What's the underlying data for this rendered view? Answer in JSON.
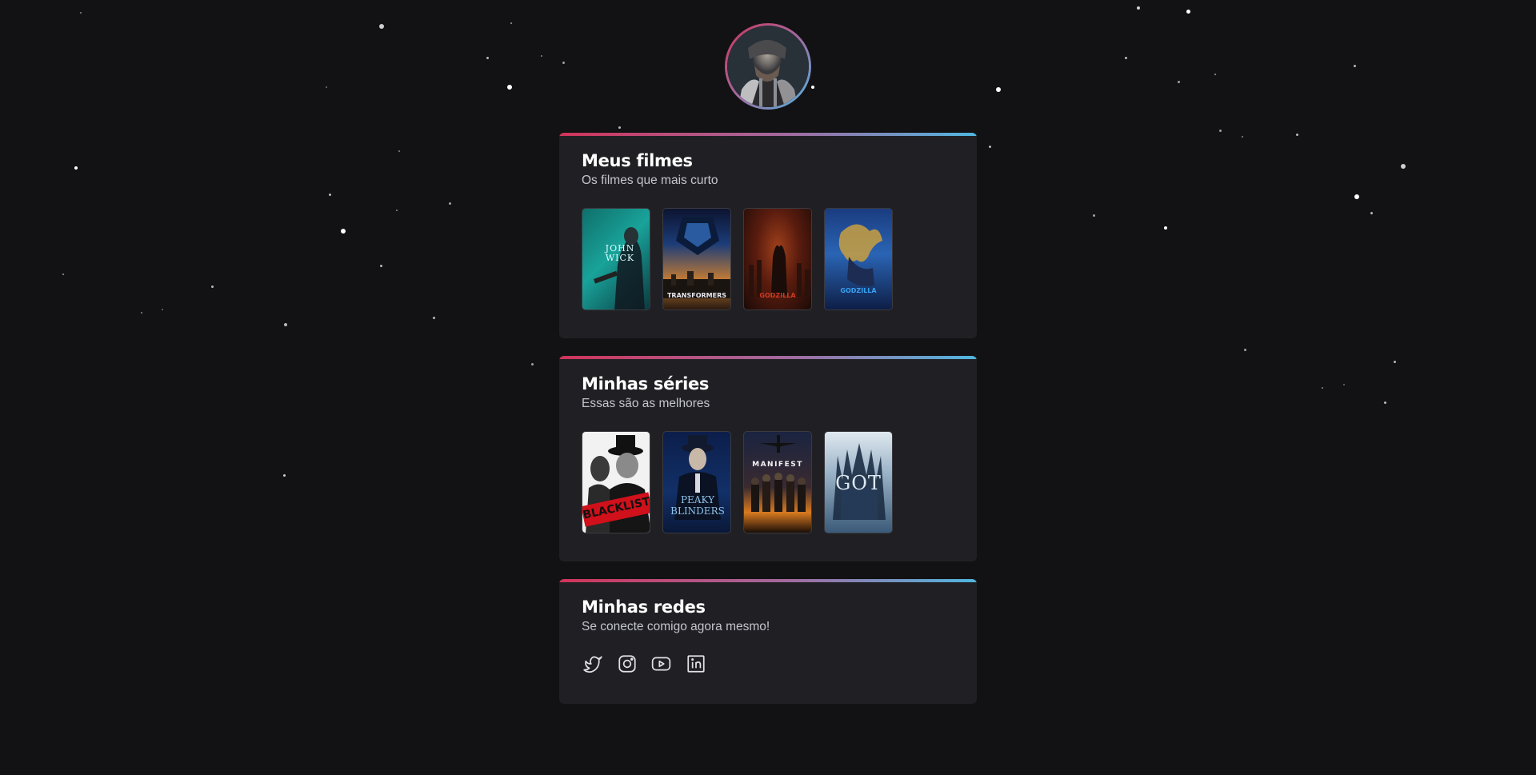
{
  "profile": {
    "avatar_icon": "profile-photo"
  },
  "sections": {
    "movies": {
      "title": "Meus filmes",
      "subtitle": "Os filmes que mais curto",
      "posters": [
        {
          "title": "JOHN WICK",
          "accent": "#1fa39a"
        },
        {
          "title": "TRANSFORMERS",
          "accent": "#c98a3c"
        },
        {
          "title": "GODZILLA",
          "accent": "#c23a1f"
        },
        {
          "title": "GODZILLA",
          "accent": "#2a7fd1"
        }
      ]
    },
    "series": {
      "title": "Minhas séries",
      "subtitle": "Essas são as melhores",
      "posters": [
        {
          "title": "BLACKLIST",
          "accent": "#d0101a"
        },
        {
          "title": "PEAKY BLINDERS",
          "accent": "#7fb4d8"
        },
        {
          "title": "MANIFEST",
          "accent": "#f0a030"
        },
        {
          "title": "GOT",
          "accent": "#c9dbe8"
        }
      ]
    },
    "socials": {
      "title": "Minhas redes",
      "subtitle": "Se conecte comigo agora mesmo!",
      "icons": [
        "twitter-icon",
        "instagram-icon",
        "youtube-icon",
        "linkedin-icon"
      ]
    }
  },
  "colors": {
    "background": "#121214",
    "card": "#202024",
    "gradient_start": "#d0345a",
    "gradient_end": "#4fb6e0"
  }
}
